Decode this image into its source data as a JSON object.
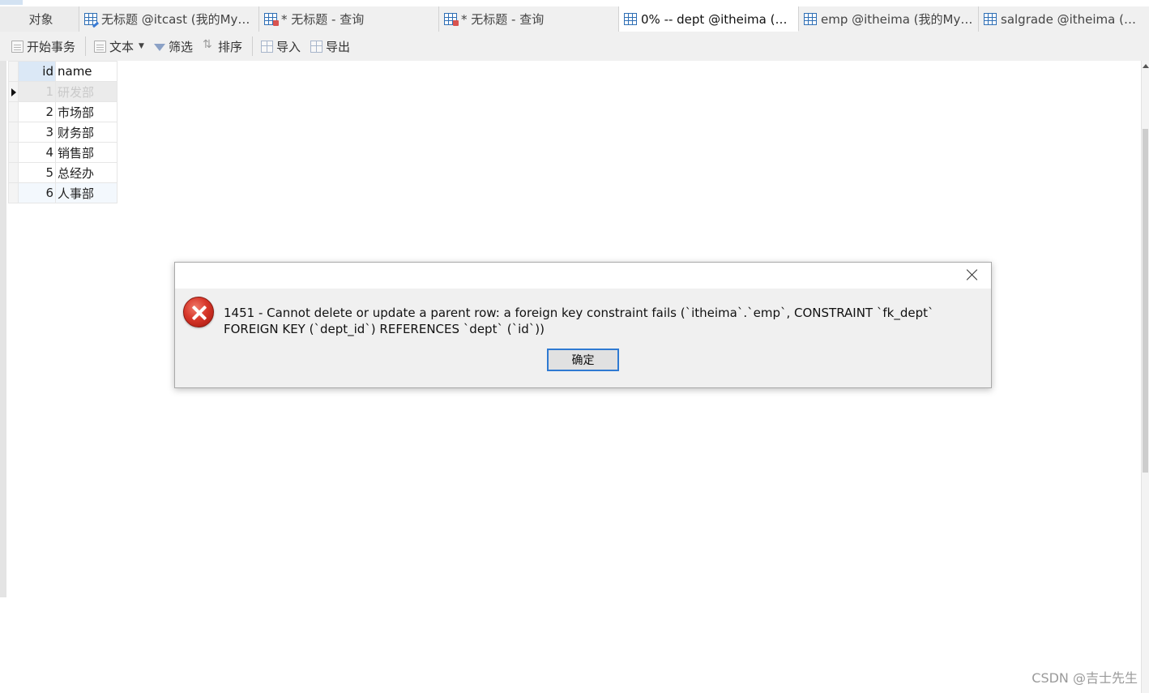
{
  "tabs": [
    {
      "label": "对象",
      "icon": "objects"
    },
    {
      "label": "无标题 @itcast (我的MyS...",
      "icon": "query-edit-icon"
    },
    {
      "label": "* 无标题 - 查询",
      "icon": "query-icon"
    },
    {
      "label": "* 无标题 - 查询",
      "icon": "query-icon"
    },
    {
      "label": "0% -- dept @itheima (我...",
      "icon": "table-icon",
      "active": true
    },
    {
      "label": "emp @itheima (我的MyS...",
      "icon": "table-icon"
    },
    {
      "label": "salgrade @itheima (我的...",
      "icon": "table-icon"
    }
  ],
  "toolbar": {
    "begin_transaction": "开始事务",
    "text": "文本",
    "filter": "筛选",
    "sort": "排序",
    "import": "导入",
    "export": "导出"
  },
  "table": {
    "columns": [
      "id",
      "name"
    ],
    "rows": [
      {
        "id": "1",
        "name": "研发部"
      },
      {
        "id": "2",
        "name": "市场部"
      },
      {
        "id": "3",
        "name": "财务部"
      },
      {
        "id": "4",
        "name": "销售部"
      },
      {
        "id": "5",
        "name": "总经办"
      },
      {
        "id": "6",
        "name": "人事部"
      }
    ]
  },
  "dialog": {
    "message": "1451 - Cannot delete or update a parent row: a foreign key constraint fails (`itheima`.`emp`, CONSTRAINT `fk_dept` FOREIGN KEY (`dept_id`) REFERENCES `dept` (`id`))",
    "ok_label": "确定"
  },
  "watermark": "CSDN @吉士先生"
}
